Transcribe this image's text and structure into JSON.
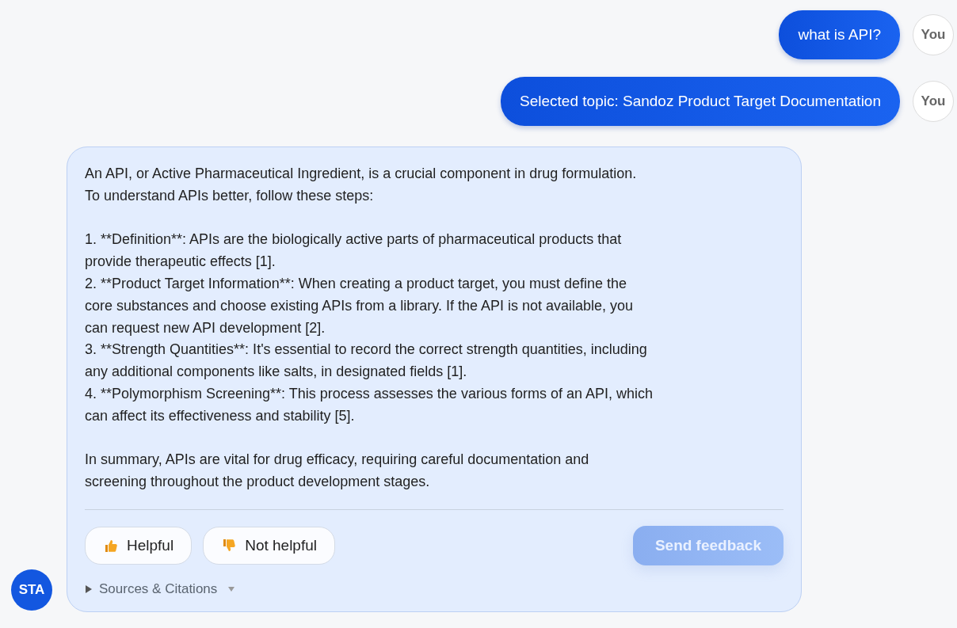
{
  "messages": [
    {
      "sender": "You",
      "text": "what is API?"
    },
    {
      "sender": "You",
      "text": "Selected topic: Sandoz Product Target Documentation"
    }
  ],
  "answer": {
    "avatar": "STA",
    "paragraphs": [
      "An API, or Active Pharmaceutical Ingredient, is a crucial component in drug formulation.\nTo understand APIs better, follow these steps:",
      "1. **Definition**: APIs are the biologically active parts of pharmaceutical products that\nprovide therapeutic effects [1].\n2. **Product Target Information**: When creating a product target, you must define the\ncore substances and choose existing APIs from a library. If the API is not available, you\ncan request new API development [2].\n3. **Strength Quantities**: It's essential to record the correct strength quantities, including\nany additional components like salts, in designated fields [1].\n4. **Polymorphism Screening**: This process assesses the various forms of an API, which\ncan affect its effectiveness and stability [5].",
      "In summary, APIs are vital for drug efficacy, requiring careful documentation and\nscreening throughout the product development stages."
    ],
    "feedback": [
      {
        "kind": "up",
        "label": "Helpful"
      },
      {
        "kind": "down",
        "label": "Not helpful"
      }
    ],
    "send_button": {
      "label": "Send feedback",
      "disabled": true
    },
    "sources": {
      "label": "Sources & Citations",
      "expanded": false
    }
  }
}
